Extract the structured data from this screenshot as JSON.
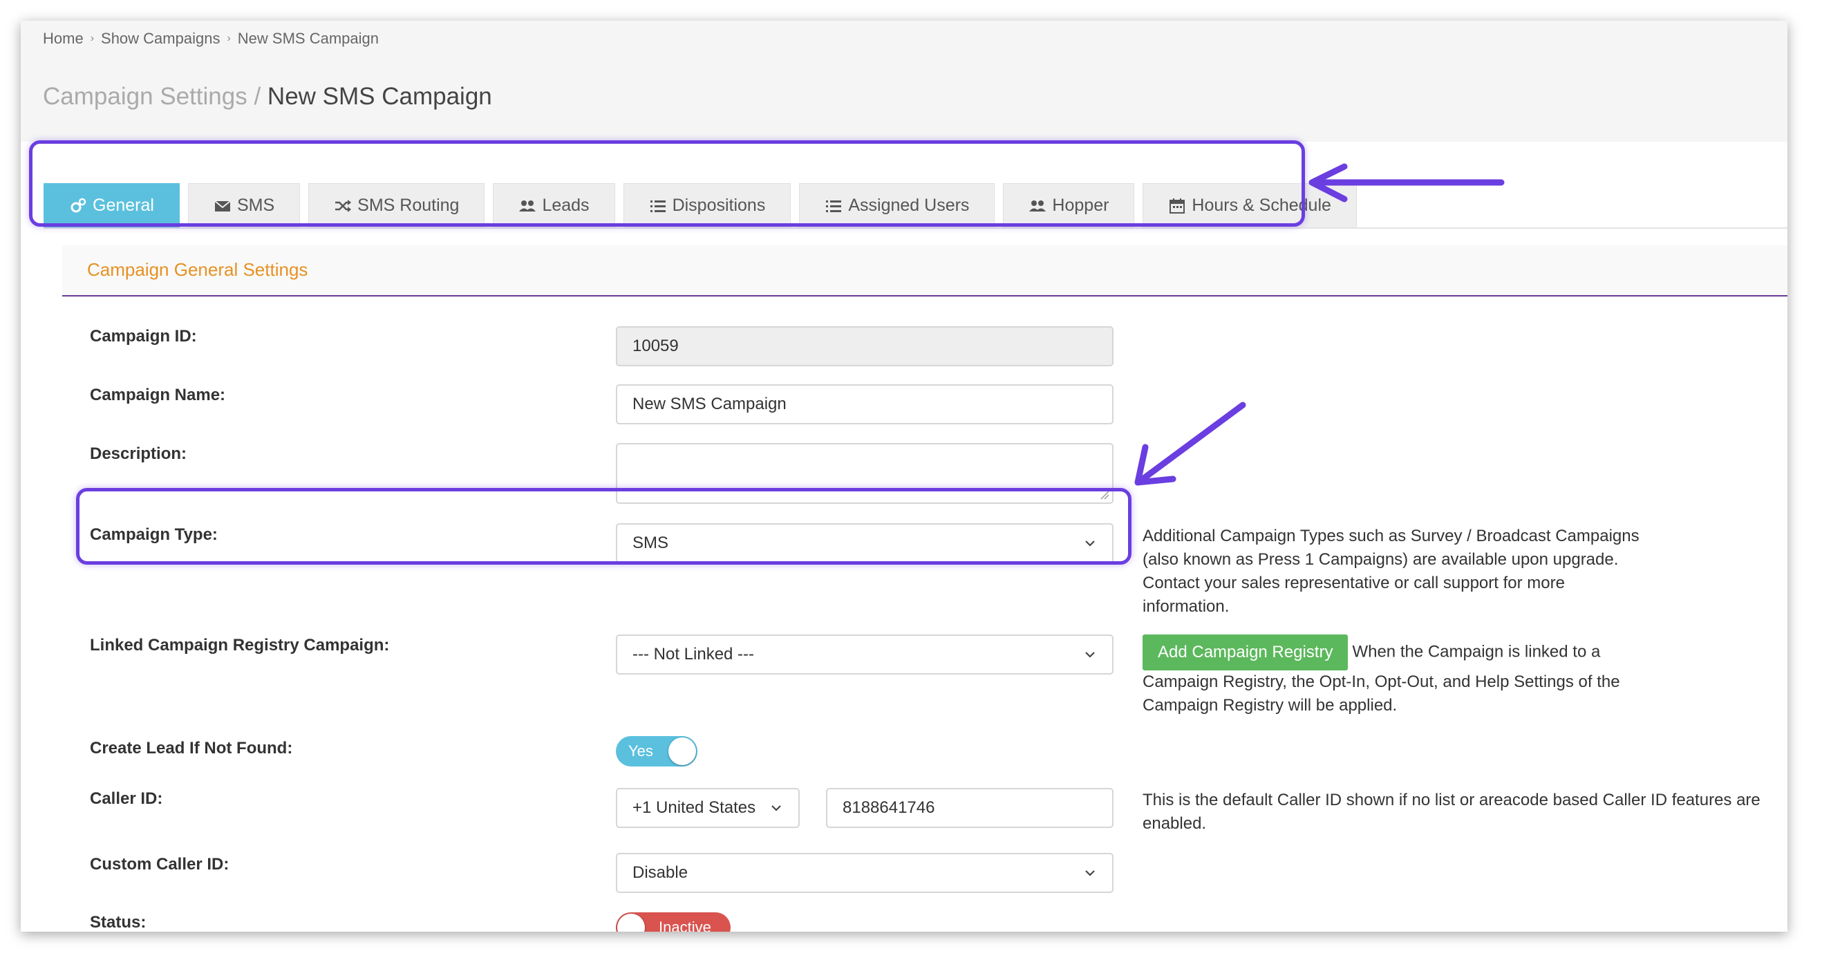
{
  "breadcrumb": {
    "items": [
      "Home",
      "Show Campaigns",
      "New SMS Campaign"
    ]
  },
  "page_title": {
    "section": "Campaign Settings",
    "separator": " / ",
    "name": "New SMS Campaign"
  },
  "tabs": [
    {
      "label": "General",
      "icon": "gears-icon",
      "active": true
    },
    {
      "label": "SMS",
      "icon": "envelope-icon"
    },
    {
      "label": "SMS Routing",
      "icon": "random-icon"
    },
    {
      "label": "Leads",
      "icon": "users-icon"
    },
    {
      "label": "Dispositions",
      "icon": "list-icon"
    },
    {
      "label": "Assigned Users",
      "icon": "list-ol-icon"
    },
    {
      "label": "Hopper",
      "icon": "users-icon"
    },
    {
      "label": "Hours & Schedule",
      "icon": "calendar-icon"
    }
  ],
  "section": {
    "title": "Campaign General Settings"
  },
  "form": {
    "campaign_id": {
      "label": "Campaign ID:",
      "value": "10059"
    },
    "campaign_name": {
      "label": "Campaign Name:",
      "value": "New SMS Campaign"
    },
    "description": {
      "label": "Description:",
      "value": ""
    },
    "campaign_type": {
      "label": "Campaign Type:",
      "value": "SMS",
      "help": "Additional Campaign Types such as Survey / Broadcast Campaigns (also known as Press 1 Campaigns) are available upon upgrade. Contact your sales representative or call support for more information."
    },
    "linked_registry": {
      "label": "Linked Campaign Registry Campaign:",
      "value": "--- Not Linked ---",
      "button": "Add Campaign Registry",
      "help": "When the Campaign is linked to a Campaign Registry, the Opt-In, Opt-Out, and Help Settings of the Campaign Registry will be applied."
    },
    "create_lead": {
      "label": "Create Lead If Not Found:",
      "value": "Yes"
    },
    "caller_id": {
      "label": "Caller ID:",
      "country": "+1 United States",
      "number": "8188641746",
      "help": "This is the default Caller ID shown if no list or areacode based Caller ID features are enabled."
    },
    "custom_caller_id": {
      "label": "Custom Caller ID:",
      "value": "Disable"
    },
    "status": {
      "label": "Status:",
      "value": "Inactive"
    }
  },
  "colors": {
    "accent": "#5bc0de",
    "section_title": "#e69122",
    "highlight": "#6a3ee0",
    "button_green": "#5cb85c",
    "inactive_red": "#d9534f"
  }
}
